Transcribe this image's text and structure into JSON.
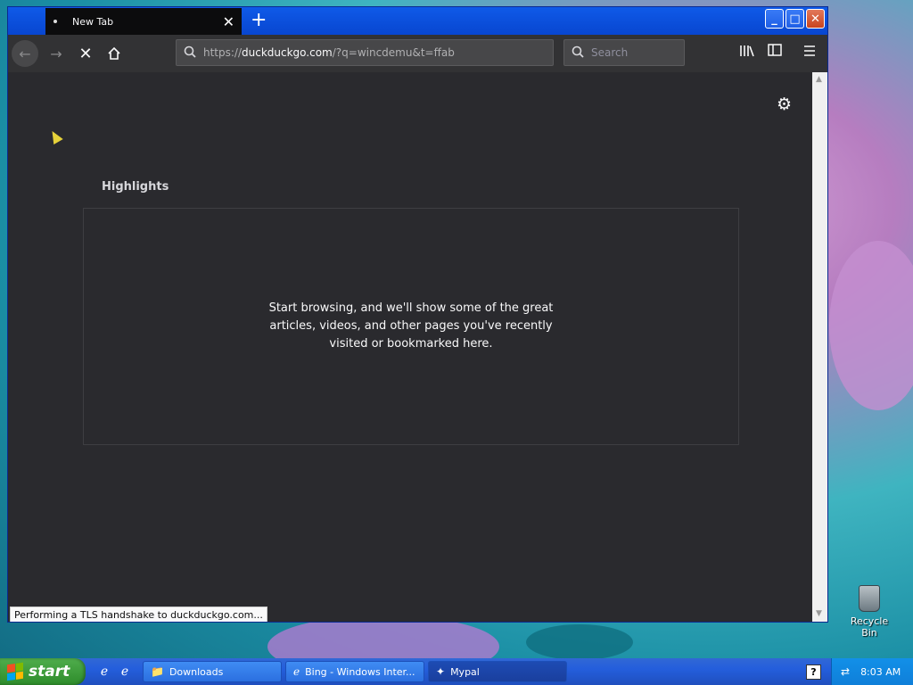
{
  "browser": {
    "tab": {
      "title": "New Tab"
    },
    "toolbar": {
      "url_prefix": "https://",
      "url_host": "duckduckgo.com",
      "url_path": "/?q=wincdemu&t=ffab",
      "search_placeholder": "Search"
    },
    "content": {
      "highlights_title": "Highlights",
      "highlights_message": "Start browsing, and we'll show some of the great articles, videos, and other pages you've recently visited or bookmarked here."
    },
    "status": "Performing a TLS handshake to duckduckgo.com..."
  },
  "desktop": {
    "recycle_bin_label": "Recycle Bin"
  },
  "taskbar": {
    "start_label": "start",
    "tasks": [
      {
        "label": "Downloads",
        "icon": "folder-icon"
      },
      {
        "label": "Bing - Windows Inter...",
        "icon": "ie-icon"
      },
      {
        "label": "Mypal",
        "icon": "mypal-icon"
      }
    ],
    "clock": "8:03 AM"
  },
  "colors": {
    "titlebar": "#0b3ec8",
    "content_bg": "#2a2a2e",
    "toolbar_bg": "#323234",
    "taskbar": "#245edc",
    "start_green": "#3a9a37"
  }
}
